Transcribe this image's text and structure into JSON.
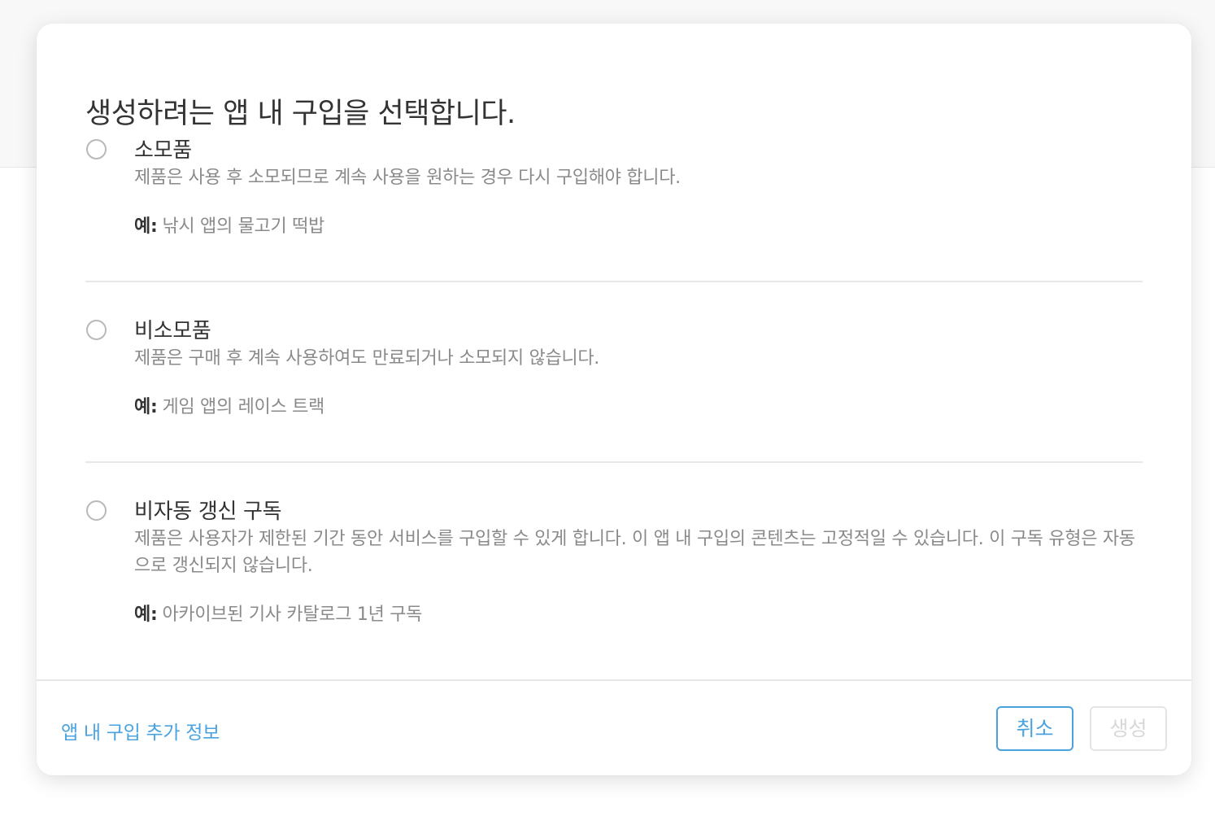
{
  "dialog": {
    "title": "생성하려는 앱 내 구입을 선택합니다.",
    "example_label": "예:",
    "options": [
      {
        "title": "소모품",
        "description": "제품은 사용 후 소모되므로 계속 사용을 원하는 경우 다시 구입해야 합니다.",
        "example": "낚시 앱의 물고기 떡밥",
        "selected": false
      },
      {
        "title": "비소모품",
        "description": "제품은 구매 후 계속 사용하여도 만료되거나 소모되지 않습니다.",
        "example": "게임 앱의 레이스 트랙",
        "selected": false
      },
      {
        "title": "비자동 갱신 구독",
        "description": "제품은 사용자가 제한된 기간 동안 서비스를 구입할 수 있게 합니다. 이 앱 내 구입의 콘텐츠는 고정적일 수 있습니다. 이 구독 유형은 자동으로 갱신되지 않습니다.",
        "example": "아카이브된 기사 카탈로그 1년 구독",
        "selected": false
      }
    ],
    "footer": {
      "learn_more_link": "앱 내 구입 추가 정보",
      "cancel_label": "취소",
      "create_label": "생성",
      "create_enabled": false
    }
  },
  "colors": {
    "accent": "#4aa3df",
    "text_primary": "#333333",
    "text_secondary": "#8a8a8a",
    "disabled": "#d8d8d8",
    "divider": "#e8e8e8"
  }
}
